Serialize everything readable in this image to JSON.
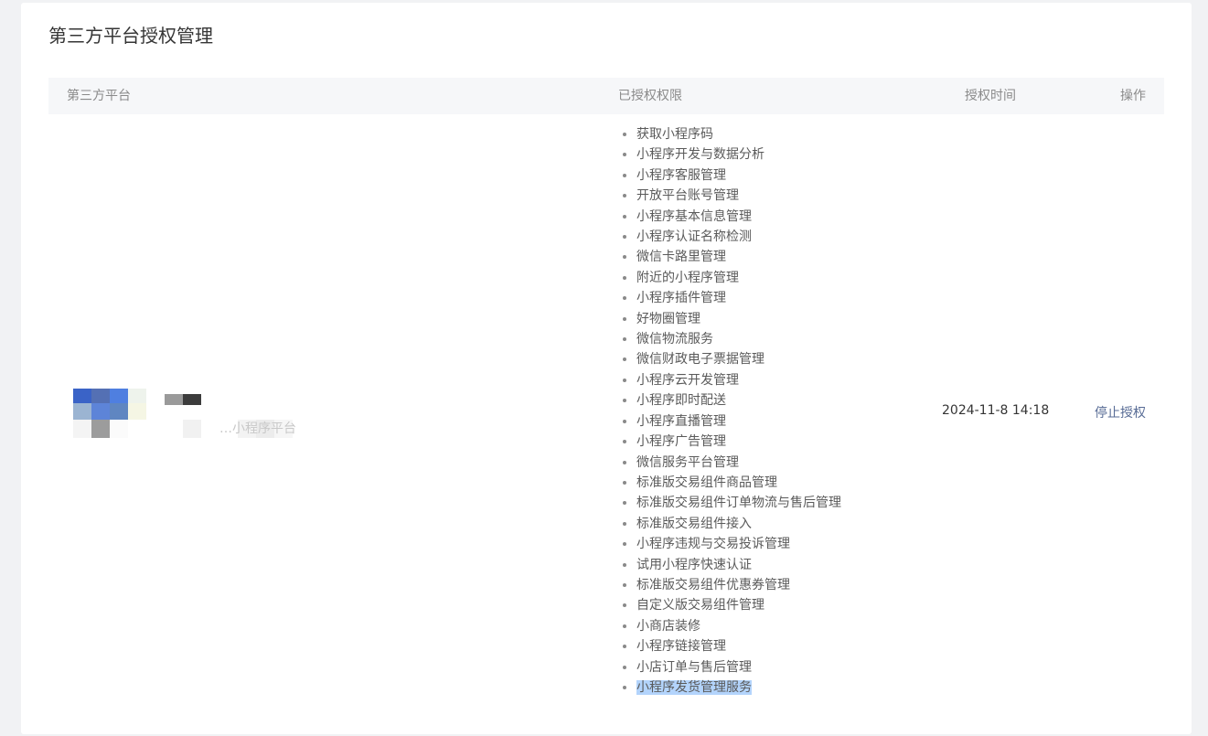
{
  "page": {
    "title": "第三方平台授权管理"
  },
  "table": {
    "headers": {
      "platform": "第三方平台",
      "permissions": "已授权权限",
      "time": "授权时间",
      "action": "操作"
    },
    "rows": [
      {
        "platform_name": "…小程序平台",
        "permissions": [
          "获取小程序码",
          "小程序开发与数据分析",
          "小程序客服管理",
          "开放平台账号管理",
          "小程序基本信息管理",
          "小程序认证名称检测",
          "微信卡路里管理",
          "附近的小程序管理",
          "小程序插件管理",
          "好物圈管理",
          "微信物流服务",
          "微信财政电子票据管理",
          "小程序云开发管理",
          "小程序即时配送",
          "小程序直播管理",
          "小程序广告管理",
          "微信服务平台管理",
          "标准版交易组件商品管理",
          "标准版交易组件订单物流与售后管理",
          "标准版交易组件接入",
          "小程序违规与交易投诉管理",
          "试用小程序快速认证",
          "标准版交易组件优惠券管理",
          "自定义版交易组件管理",
          "小商店装修",
          "小程序链接管理",
          "小店订单与售后管理",
          "小程序发货管理服务"
        ],
        "selected_permission_index": 27,
        "auth_time": "2024-11-8 14:18",
        "action_label": "停止授权"
      }
    ]
  },
  "colors": {
    "link": "#576b95",
    "header_bg": "#f6f7f9",
    "selection": "#b3d4fc"
  }
}
